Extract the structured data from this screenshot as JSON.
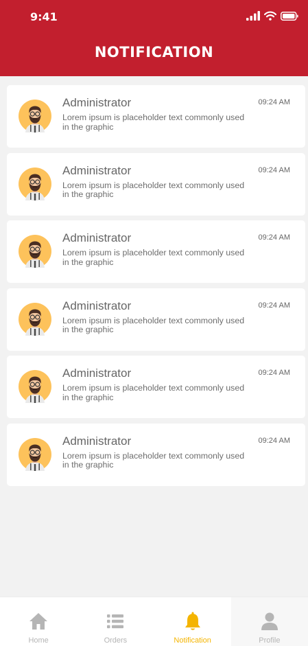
{
  "status": {
    "time": "9:41"
  },
  "header": {
    "title": "NOTIFICATION"
  },
  "notifications": [
    {
      "title": "Administrator",
      "message": "Lorem ipsum is placeholder text commonly used in the graphic",
      "time": "09:24 AM"
    },
    {
      "title": "Administrator",
      "message": "Lorem ipsum is placeholder text commonly used in the graphic",
      "time": "09:24 AM"
    },
    {
      "title": "Administrator",
      "message": "Lorem ipsum is placeholder text commonly used in the graphic",
      "time": "09:24 AM"
    },
    {
      "title": "Administrator",
      "message": "Lorem ipsum is placeholder text commonly used in the graphic",
      "time": "09:24 AM"
    },
    {
      "title": "Administrator",
      "message": "Lorem ipsum is placeholder text commonly used in the graphic",
      "time": "09:24 AM"
    },
    {
      "title": "Administrator",
      "message": "Lorem ipsum is placeholder text commonly used in the graphic",
      "time": "09:24 AM"
    }
  ],
  "tabbar": {
    "items": [
      {
        "label": "Home",
        "icon": "home-icon"
      },
      {
        "label": "Orders",
        "icon": "list-icon"
      },
      {
        "label": "Notification",
        "icon": "bell-icon",
        "active": true
      },
      {
        "label": "Profile",
        "icon": "user-icon"
      }
    ]
  },
  "colors": {
    "brand": "#c21f2e",
    "active_tab": "#f4b400",
    "inactive_tab": "#b5b5b5",
    "background": "#f2f2f2"
  }
}
